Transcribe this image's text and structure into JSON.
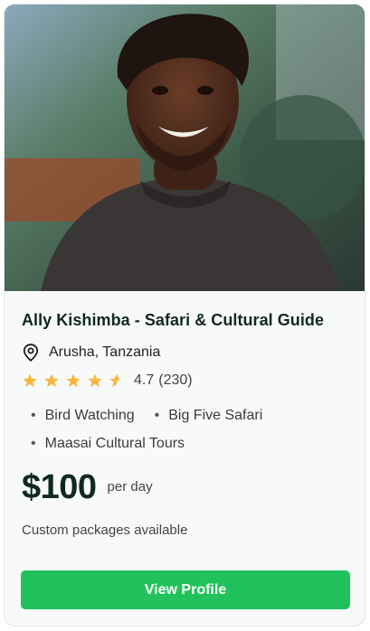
{
  "guide": {
    "name_title": "Ally Kishimba - Safari & Cultural Guide",
    "location": "Arusha, Tanzania",
    "rating_value": "4.7",
    "rating_count": "(230)",
    "stars": 4.5,
    "specialties": [
      "Bird Watching",
      "Big Five Safari",
      "Maasai Cultural Tours"
    ],
    "price": "$100",
    "price_unit": "per day",
    "note": "Custom packages available",
    "cta_label": "View Profile"
  },
  "colors": {
    "accent": "#21c25d",
    "star": "#f4b740",
    "heading": "#12291e"
  },
  "icons": {
    "location": "map-pin-icon",
    "star": "star-icon",
    "half_star": "half-star-icon"
  }
}
